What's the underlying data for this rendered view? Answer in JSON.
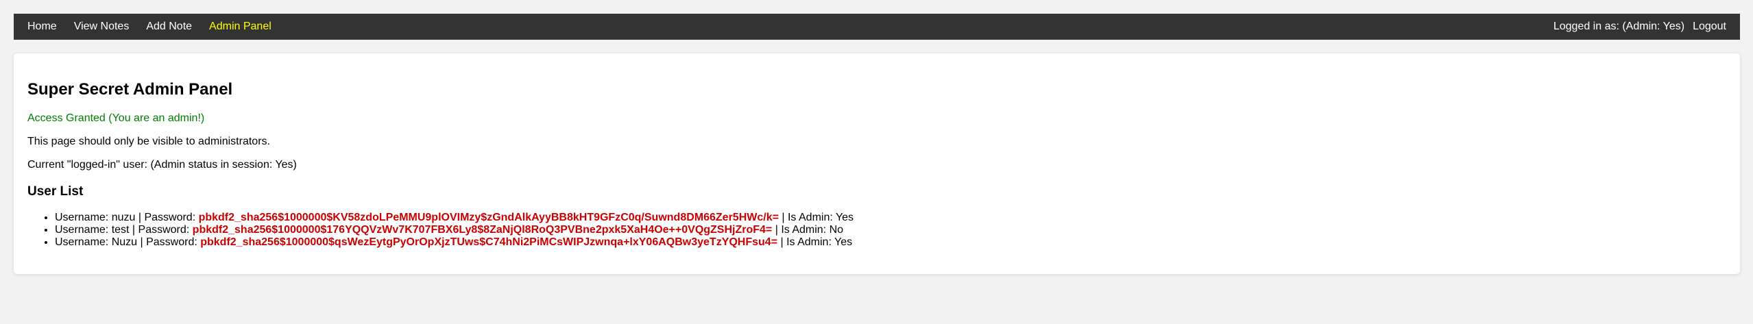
{
  "nav": {
    "links": [
      {
        "label": "Home",
        "active": false
      },
      {
        "label": "View Notes",
        "active": false
      },
      {
        "label": "Add Note",
        "active": false
      },
      {
        "label": "Admin Panel",
        "active": true
      }
    ],
    "status": "Logged in as: (Admin: Yes)",
    "logout_label": "Logout",
    "active_color": "#ffff00",
    "bar_color": "#333333"
  },
  "main": {
    "title": "Super Secret Admin Panel",
    "access_message": "Access Granted (You are an admin!)",
    "access_color": "#008000",
    "visibility_note": "This page should only be visible to administrators.",
    "current_user_note": "Current \"logged-in\" user: (Admin status in session: Yes)",
    "user_list_heading": "User List",
    "users": [
      {
        "username_prefix": "Username: nuzu | Password: ",
        "password_hash": "pbkdf2_sha256$1000000$KV58zdoLPeMMU9plOVIMzy$zGndAlkAyyBB8kHT9GFzC0q/Suwnd8DM66Zer5HWc/k=",
        "admin_suffix": " | Is Admin: Yes"
      },
      {
        "username_prefix": "Username: test | Password: ",
        "password_hash": "pbkdf2_sha256$1000000$176YQQVzWv7K707FBX6Ly8$8ZaNjQl8RoQ3PVBne2pxk5XaH4Oe++0VQgZSHjZroF4=",
        "admin_suffix": " | Is Admin: No"
      },
      {
        "username_prefix": "Username: Nuzu | Password: ",
        "password_hash": "pbkdf2_sha256$1000000$qsWezEytgPyOrOpXjzTUws$C74hNi2PiMCsWIPJzwnqa+lxY06AQBw3yeTzYQHFsu4=",
        "admin_suffix": " | Is Admin: Yes"
      }
    ],
    "hash_color": "#cc0000"
  }
}
